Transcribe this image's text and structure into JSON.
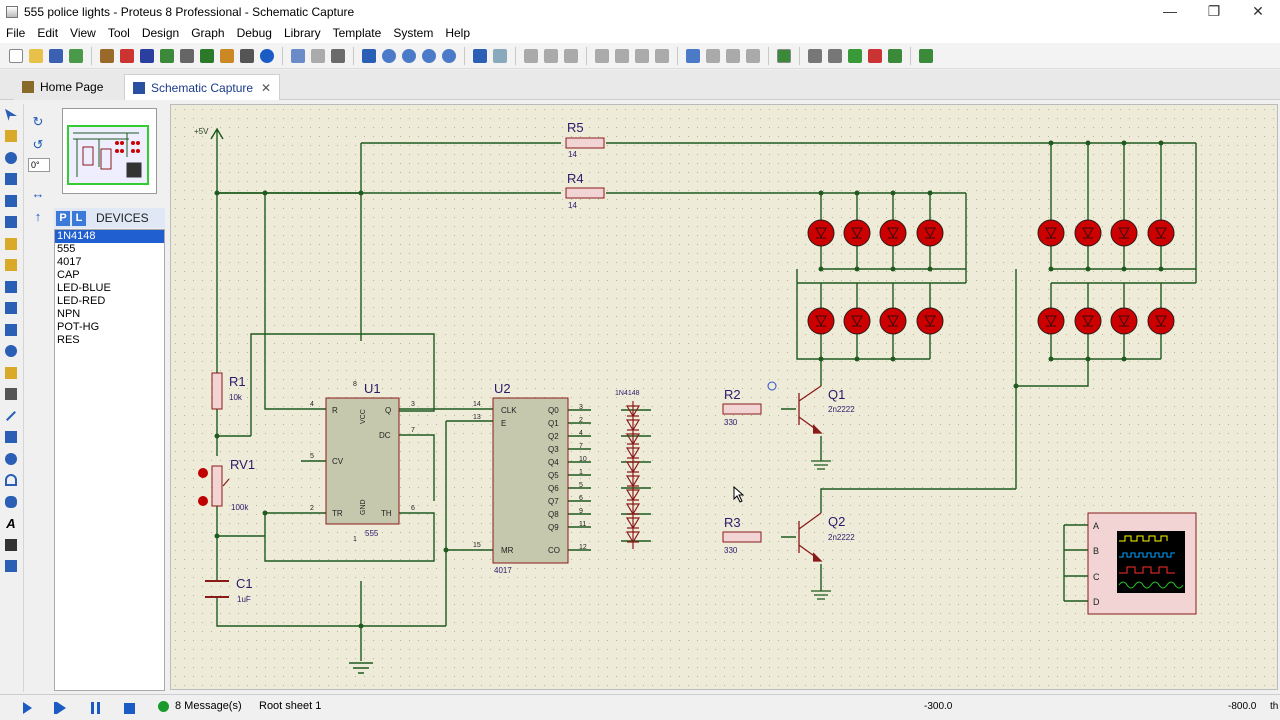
{
  "window": {
    "title": "555 police lights - Proteus 8 Professional - Schematic Capture"
  },
  "menu": [
    "File",
    "Edit",
    "View",
    "Tool",
    "Design",
    "Graph",
    "Debug",
    "Library",
    "Template",
    "System",
    "Help"
  ],
  "tabs": [
    {
      "label": "Home Page"
    },
    {
      "label": "Schematic Capture"
    }
  ],
  "rotation": {
    "angle_value": "0°"
  },
  "devices": {
    "header": "DEVICES",
    "tab_p": "P",
    "tab_l": "L",
    "items": [
      "1N4148",
      "555",
      "4017",
      "CAP",
      "LED-BLUE",
      "LED-RED",
      "NPN",
      "POT-HG",
      "RES"
    ],
    "selected": "1N4148"
  },
  "schematic": {
    "power_label": "+5V",
    "r5": {
      "ref": "R5",
      "value": "14"
    },
    "r4": {
      "ref": "R4",
      "value": "14"
    },
    "r1": {
      "ref": "R1",
      "value": "10k"
    },
    "rv1": {
      "ref": "RV1",
      "value": "100k"
    },
    "c1": {
      "ref": "C1",
      "value": "1uF"
    },
    "u1": {
      "ref": "U1",
      "part": "555",
      "pins_left": [
        "R",
        "CV",
        "TR"
      ],
      "pins_right": [
        "Q",
        "DC",
        "TH"
      ],
      "top_pin": "VCC",
      "bottom_pin": "GND",
      "pin_nums": {
        "r": "4",
        "cv": "5",
        "tr": "2",
        "q": "3",
        "dc": "7",
        "th": "6",
        "vcc": "8",
        "gnd": "1"
      }
    },
    "u2": {
      "ref": "U2",
      "part": "4017",
      "pins_left": [
        "CLK",
        "E",
        "MR"
      ],
      "pins_right": [
        "Q0",
        "Q1",
        "Q2",
        "Q3",
        "Q4",
        "Q5",
        "Q6",
        "Q7",
        "Q8",
        "Q9",
        "CO"
      ],
      "left_nums": [
        "14",
        "13",
        "15"
      ],
      "right_nums": [
        "3",
        "2",
        "4",
        "7",
        "10",
        "1",
        "5",
        "6",
        "9",
        "11",
        "12"
      ]
    },
    "diodes_label": "1N4148",
    "r2": {
      "ref": "R2",
      "value": "330"
    },
    "r3": {
      "ref": "R3",
      "value": "330"
    },
    "q1": {
      "ref": "Q1",
      "value": "2n2222"
    },
    "q2": {
      "ref": "Q2",
      "value": "2n2222"
    },
    "scope": {
      "channels": [
        "A",
        "B",
        "C",
        "D"
      ]
    }
  },
  "status": {
    "messages": "8 Message(s)",
    "sheet": "Root sheet 1",
    "x": "-300.0",
    "y": "-800.0",
    "unit": "th"
  },
  "colors": {
    "wire": "#1f5a1f",
    "component": "#8a1a1a",
    "led": "#cc0000",
    "canvas": "#eeecd9"
  }
}
